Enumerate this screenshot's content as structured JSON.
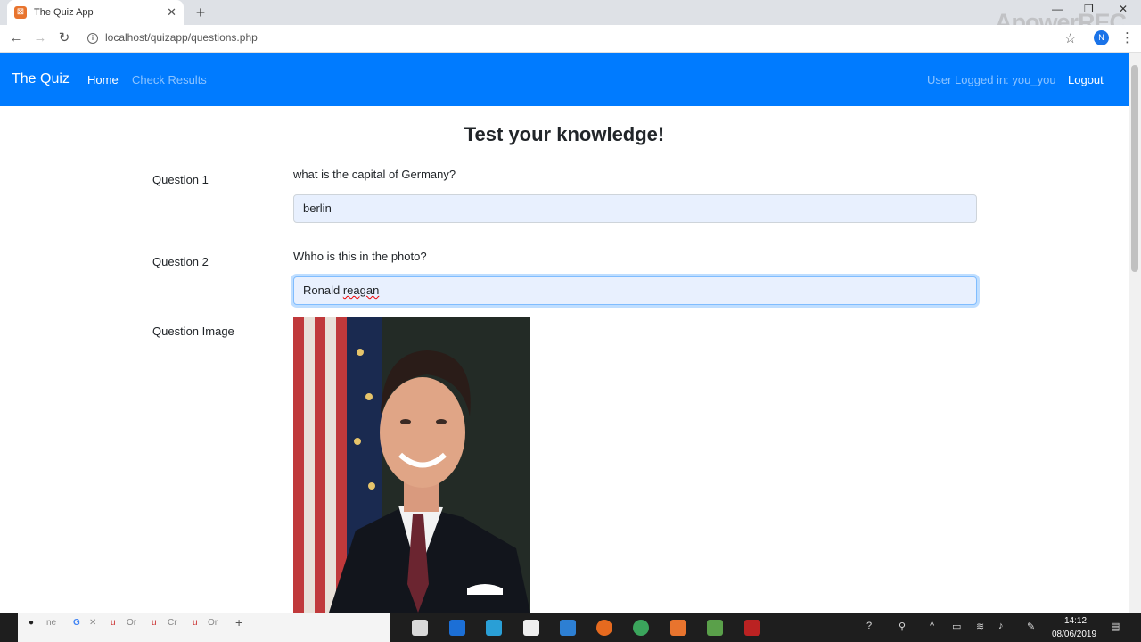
{
  "browser": {
    "tab_title": "The Quiz App",
    "url": "localhost/quizapp/questions.php",
    "profile_initial": "N",
    "watermark": "ApowerREC"
  },
  "navbar": {
    "brand": "The Quiz",
    "home": "Home",
    "check_results": "Check Results",
    "user_status": "User Logged in: you_you",
    "logout": "Logout",
    "bg_color": "#007bff"
  },
  "page": {
    "title": "Test your knowledge!",
    "questions": [
      {
        "label": "Question 1",
        "text": "what is the capital of Germany?",
        "answer": "berlin"
      },
      {
        "label": "Question 2",
        "text": "Whho is this in the photo?",
        "answer_first": "Ronald",
        "answer_second": "reagan"
      }
    ],
    "image_label": "Question Image"
  },
  "taskbar": {
    "mini_tabs": [
      "ne",
      "Or",
      "Cr",
      "Or"
    ],
    "time": "14:12",
    "date": "08/06/2019"
  }
}
